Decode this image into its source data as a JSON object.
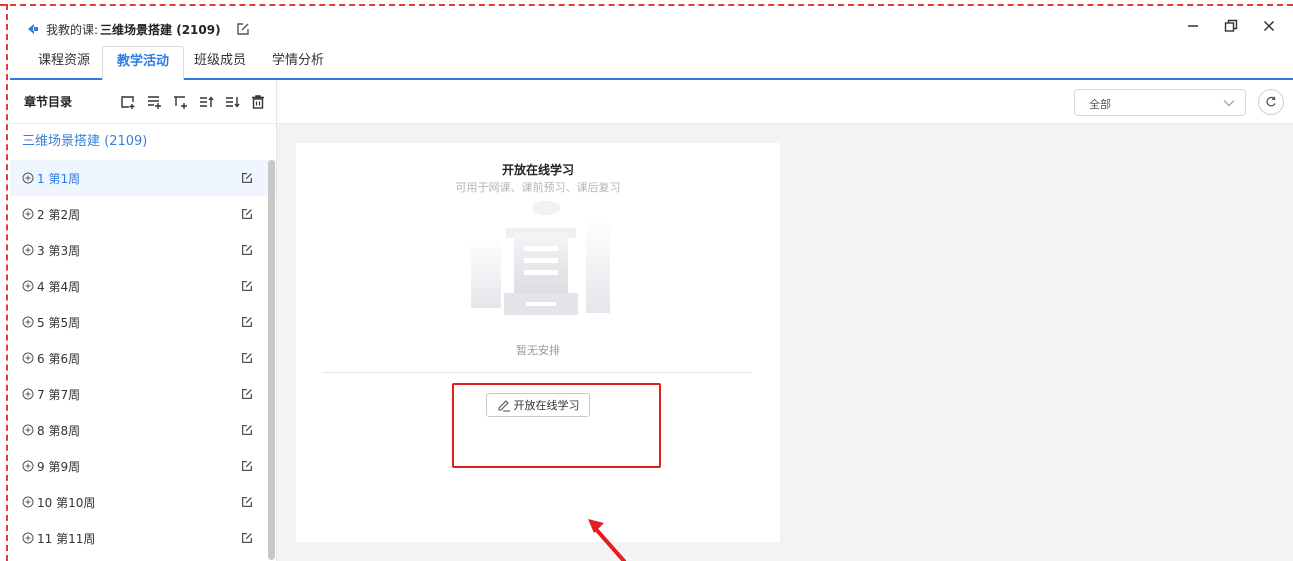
{
  "window": {
    "title_prefix": "我教的课:",
    "course_name": "三维场景搭建 (2109)"
  },
  "tabs": [
    {
      "label": "课程资源",
      "active": false
    },
    {
      "label": "教学活动",
      "active": true
    },
    {
      "label": "班级成员",
      "active": false
    },
    {
      "label": "学情分析",
      "active": false
    }
  ],
  "sidebar": {
    "title": "章节目录",
    "course": "三维场景搭建 (2109)",
    "items": [
      {
        "label": "1 第1周"
      },
      {
        "label": "2 第2周"
      },
      {
        "label": "3 第3周"
      },
      {
        "label": "4 第4周"
      },
      {
        "label": "5 第5周"
      },
      {
        "label": "6 第6周"
      },
      {
        "label": "7 第7周"
      },
      {
        "label": "8 第8周"
      },
      {
        "label": "9 第9周"
      },
      {
        "label": "10 第10周"
      },
      {
        "label": "11 第11周"
      }
    ]
  },
  "filter": {
    "selected": "全部"
  },
  "card": {
    "title": "开放在线学习",
    "subtitle": "可用于网课、课前预习、课后复习",
    "empty_text": "暂无安排",
    "button_label": "开放在线学习"
  },
  "colors": {
    "accent": "#2d7be5",
    "annotation": "#e02020"
  }
}
